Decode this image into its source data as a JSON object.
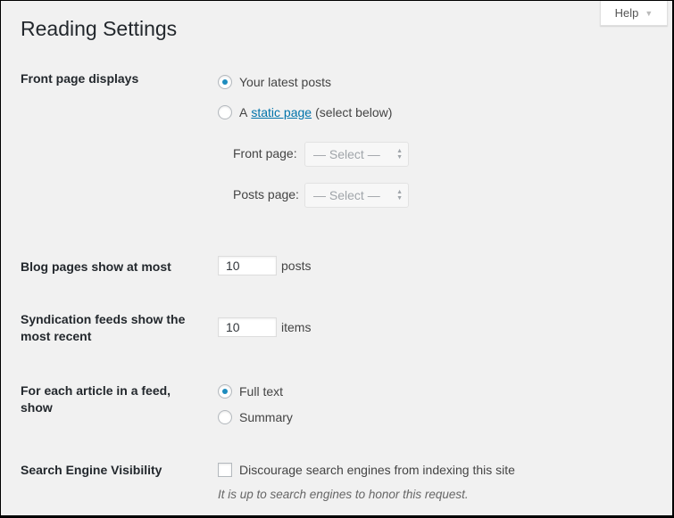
{
  "header": {
    "title": "Reading Settings",
    "help_label": "Help",
    "help_arrow": "▼"
  },
  "front_page": {
    "label": "Front page displays",
    "options": [
      {
        "label": "Your latest posts",
        "selected": true
      },
      {
        "prefix": "A",
        "link_text": "static page",
        "suffix": "(select below)",
        "selected": false
      }
    ],
    "front_page_select": {
      "label": "Front page:",
      "value": "— Select —"
    },
    "posts_page_select": {
      "label": "Posts page:",
      "value": "— Select —"
    }
  },
  "blog_pages": {
    "label": "Blog pages show at most",
    "value": "10",
    "unit": "posts"
  },
  "syndication": {
    "label": "Syndication feeds show the most recent",
    "value": "10",
    "unit": "items"
  },
  "feed_article": {
    "label": "For each article in a feed, show",
    "options": [
      {
        "label": "Full text",
        "selected": true
      },
      {
        "label": "Summary",
        "selected": false
      }
    ]
  },
  "search_visibility": {
    "label": "Search Engine Visibility",
    "checkbox_label": "Discourage search engines from indexing this site",
    "checked": false,
    "description": "It is up to search engines to honor this request."
  },
  "colors": {
    "accent": "#1e8cbe",
    "link": "#0073aa",
    "background": "#f1f1f1"
  }
}
